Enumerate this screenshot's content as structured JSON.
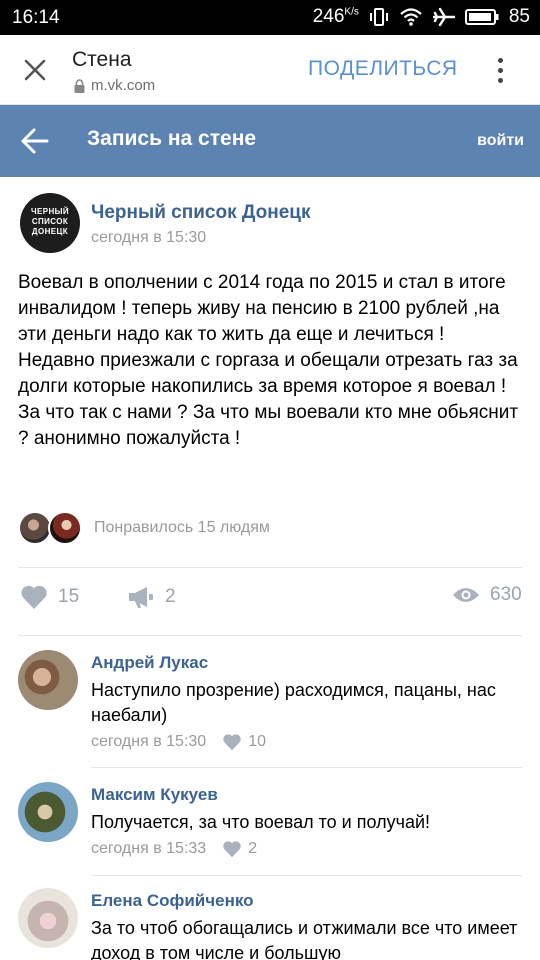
{
  "status_bar": {
    "time": "16:14",
    "speed": "246",
    "speed_unit": "K/s",
    "battery": "85"
  },
  "tab_bar": {
    "title": "Стена",
    "url": "m.vk.com",
    "share_label": "ПОДЕЛИТЬСЯ"
  },
  "vk_header": {
    "title": "Запись на стене",
    "login_label": "войти"
  },
  "post": {
    "author": "Черный список Донецк",
    "avatar_lines": [
      "ЧЕРНЫЙ",
      "СПИСОК",
      "ДОНЕЦК"
    ],
    "time": "сегодня в 15:30",
    "text": "Воевал в ополчении с 2014 года по 2015 и стал в итоге инвалидом ! теперь живу на пенсию в 2100 рублей ,на эти деньги надо как то жить да еще и лечиться ! Недавно приезжали с горгаза и обещали отрезать газ за долги которые накопились за время которое я воевал ! За что так с нами ? За что мы воевали кто мне обьяснит ? анонимно пожалуйста !",
    "liked_by": "Понравилось 15 людям",
    "likes": "15",
    "shares": "2",
    "views": "630"
  },
  "comments": [
    {
      "name": "Андрей Лукас",
      "text": "Наступило прозрение) расходимся, пацаны, нас наебали)",
      "time": "сегодня в 15:30",
      "likes": "10"
    },
    {
      "name": "Максим Кукуев",
      "text": "Получается, за что воевал то и получай!",
      "time": "сегодня в 15:33",
      "likes": "2"
    },
    {
      "name": "Елена Софийченко",
      "text": "За то чтоб обогащались и отжимали все что имеет доход в том числе и большую"
    }
  ],
  "colors": {
    "vk_header": "#5c83b2",
    "link": "#3c6391",
    "share": "#5b8fd2",
    "muted": "#9a9a9a"
  }
}
